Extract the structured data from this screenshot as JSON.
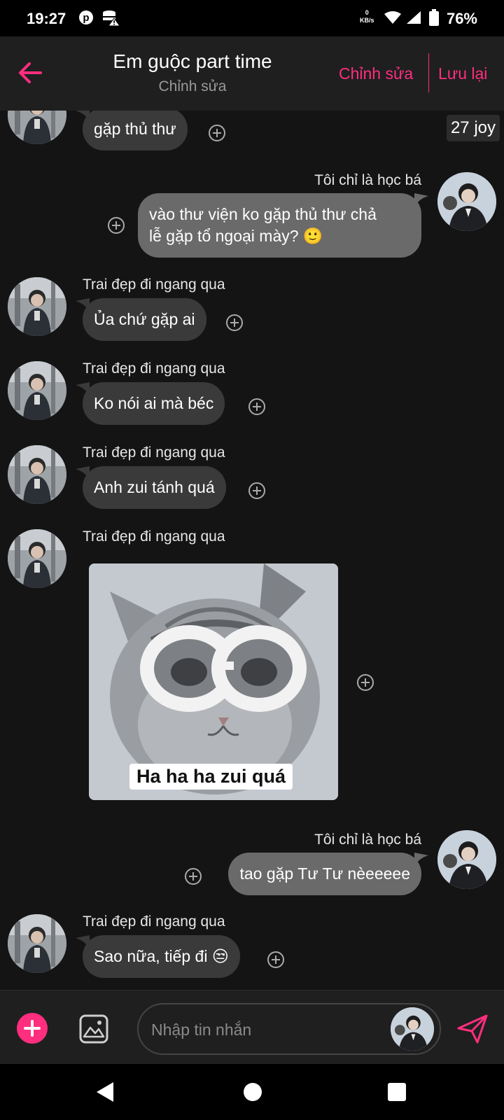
{
  "status_bar": {
    "time": "19:27",
    "net_speed_value": "0",
    "net_speed_unit": "KB/s",
    "battery": "76%",
    "icons": [
      "pinterest-icon",
      "data-saver-warning-icon",
      "wifi-icon",
      "signal-icon",
      "battery-icon"
    ]
  },
  "header": {
    "title": "Em guộc part time",
    "subtitle": "Chỉnh sửa",
    "edit_label": "Chỉnh sửa",
    "save_label": "Lưu lại",
    "accent": "#ff2e7e"
  },
  "chat": {
    "date_chip": "27 joy",
    "messages": [
      {
        "sender": "",
        "text": "gặp thủ thư",
        "from_me": false
      },
      {
        "sender": "Tôi chỉ là học bá",
        "text": "vào thư viện ko gặp thủ thư chả",
        "text2": "lễ gặp tổ ngoại mày? 🙂",
        "from_me": true
      },
      {
        "sender": "Trai đẹp đi ngang qua",
        "text": "Ủa chứ gặp ai",
        "from_me": false
      },
      {
        "sender": "Trai đẹp đi ngang qua",
        "text": "Ko nói ai mà béc",
        "from_me": false
      },
      {
        "sender": "Trai đẹp đi ngang qua",
        "text": "Anh zui tánh quá",
        "from_me": false
      },
      {
        "sender": "Trai đẹp đi ngang qua",
        "sticker_caption": "Ha ha ha zui quá",
        "from_me": false
      },
      {
        "sender": "Tôi chỉ là học bá",
        "text": "tao gặp Tư Tư nèeeeee",
        "from_me": true
      },
      {
        "sender": "Trai đẹp đi ngang qua",
        "text": "Sao nữa, tiếp đi 😒",
        "from_me": false
      }
    ]
  },
  "composer": {
    "placeholder": "Nhập tin nhắn"
  },
  "colors": {
    "background": "#141414",
    "bubble_other": "#3a3a3a",
    "bubble_me": "#6a6a6a",
    "accent": "#ff2e7e"
  }
}
